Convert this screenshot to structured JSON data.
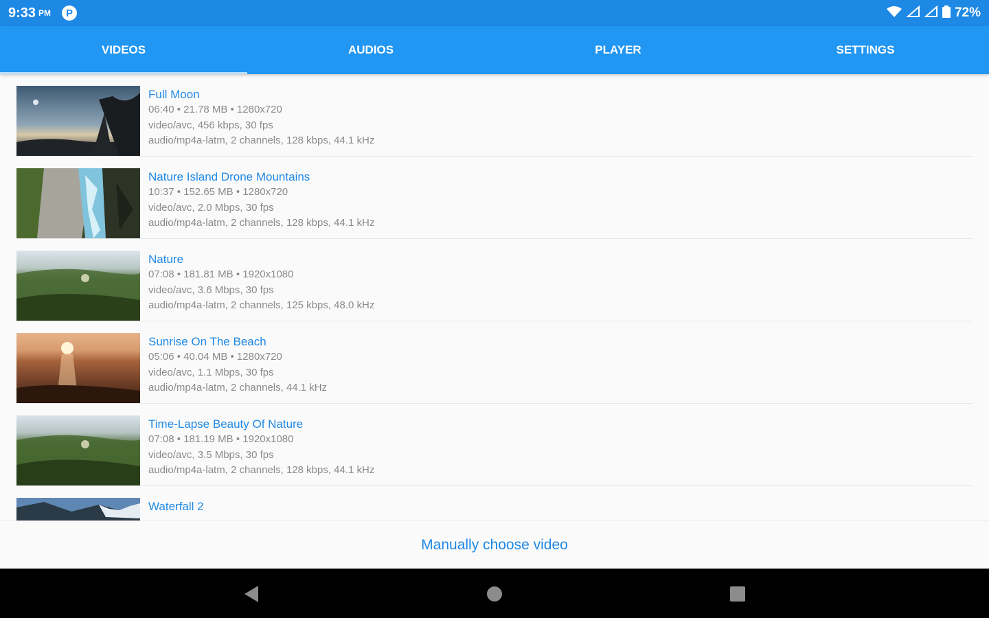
{
  "status_bar": {
    "time": "9:33",
    "ampm": "PM",
    "notification_glyph": "P",
    "battery_text": "72%"
  },
  "tabs": [
    {
      "label": "VIDEOS",
      "active": true
    },
    {
      "label": "AUDIOS",
      "active": false
    },
    {
      "label": "PLAYER",
      "active": false
    },
    {
      "label": "SETTINGS",
      "active": false
    }
  ],
  "videos": [
    {
      "title": "Full Moon",
      "info": "06:40 • 21.78 MB • 1280x720",
      "video": "video/avc, 456 kbps, 30 fps",
      "audio": "audio/mp4a-latm, 2 channels, 128 kbps, 44.1 kHz"
    },
    {
      "title": "Nature Island Drone Mountains",
      "info": "10:37 • 152.65 MB • 1280x720",
      "video": "video/avc, 2.0 Mbps, 30 fps",
      "audio": "audio/mp4a-latm, 2 channels, 128 kbps, 44.1 kHz"
    },
    {
      "title": "Nature",
      "info": "07:08 • 181.81 MB • 1920x1080",
      "video": "video/avc, 3.6 Mbps, 30 fps",
      "audio": "audio/mp4a-latm, 2 channels, 125 kbps, 48.0 kHz"
    },
    {
      "title": "Sunrise On The Beach",
      "info": "05:06 • 40.04 MB • 1280x720",
      "video": "video/avc, 1.1 Mbps, 30 fps",
      "audio": "audio/mp4a-latm, 2 channels, 44.1 kHz"
    },
    {
      "title": "Time-Lapse Beauty Of Nature",
      "info": "07:08 • 181.19 MB • 1920x1080",
      "video": "video/avc, 3.5 Mbps, 30 fps",
      "audio": "audio/mp4a-latm, 2 channels, 128 kbps, 44.1 kHz"
    },
    {
      "title": "Waterfall 2"
    }
  ],
  "footer": {
    "manual_button": "Manually choose video"
  },
  "colors": {
    "status_bar": "#1e88e5",
    "tab_bar": "#2196f3",
    "accent": "#1e88e5",
    "meta_text": "#8a8a8a"
  },
  "icons": {
    "wifi": "wifi-icon",
    "signal": "signal-icon",
    "battery": "battery-icon",
    "back": "back-icon",
    "home": "home-icon",
    "recents": "recents-icon"
  }
}
